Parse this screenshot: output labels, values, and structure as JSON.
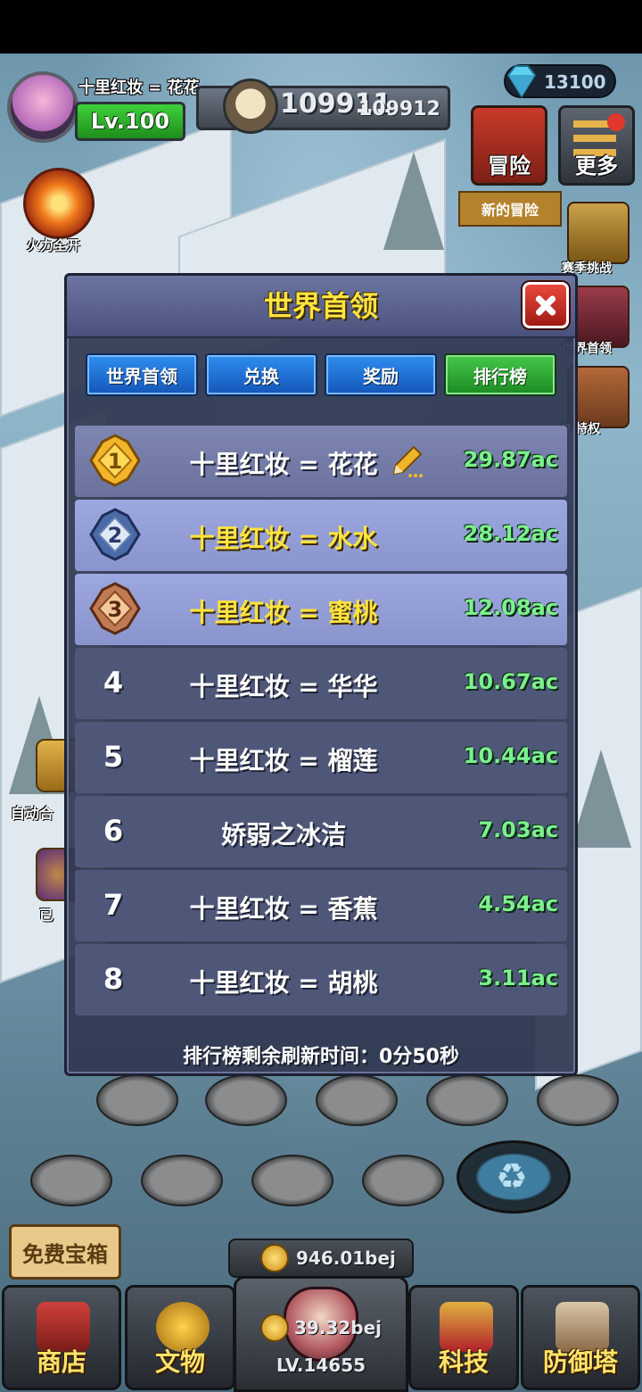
{
  "player": {
    "name": "十里红妆 = 花花",
    "level": "Lv.100",
    "power_main": "109911",
    "power_sub": "109912",
    "gems": "13100"
  },
  "left_buttons": {
    "fire_label": "火力全开",
    "auto_label": "自动合",
    "done_label": "已"
  },
  "right_buttons": {
    "adventure": "冒险",
    "adventure_sub": "新的冒险",
    "more": "更多",
    "season": "赛季挑战",
    "world_boss": "世界首领",
    "vip": "P 特权"
  },
  "modal": {
    "title": "世界首领",
    "tabs": [
      {
        "label": "世界首领",
        "active": false
      },
      {
        "label": "兑换",
        "active": false
      },
      {
        "label": "奖励",
        "active": false
      },
      {
        "label": "排行榜",
        "active": true
      }
    ],
    "rows": [
      {
        "rank": "1",
        "name": "十里红妆 = 花花",
        "score": "29.87ac"
      },
      {
        "rank": "2",
        "name": "十里红妆 = 水水",
        "score": "28.12ac"
      },
      {
        "rank": "3",
        "name": "十里红妆 = 蜜桃",
        "score": "12.08ac"
      },
      {
        "rank": "4",
        "name": "十里红妆 = 华华",
        "score": "10.67ac"
      },
      {
        "rank": "5",
        "name": "十里红妆 = 榴莲",
        "score": "10.44ac"
      },
      {
        "rank": "6",
        "name": "娇弱之冰洁",
        "score": "7.03ac"
      },
      {
        "rank": "7",
        "name": "十里红妆 = 香蕉",
        "score": "4.54ac"
      },
      {
        "rank": "8",
        "name": "十里红妆 = 胡桃",
        "score": "3.11ac"
      }
    ],
    "refresh_text": "排行榜剩余刷新时间：0分50秒"
  },
  "bottom": {
    "free_chest": "免费宝箱",
    "coins": "946.01bej",
    "center_coins": "39.32bej",
    "center_level": "LV.14655",
    "nav": [
      "商店",
      "文物",
      "科技",
      "防御塔"
    ]
  },
  "colors": {
    "title_yellow": "#ffe340",
    "score_green": "#7cf08e",
    "tab_blue": "#2f8ff0",
    "tab_green": "#45c84a",
    "close_red": "#e8493d"
  }
}
